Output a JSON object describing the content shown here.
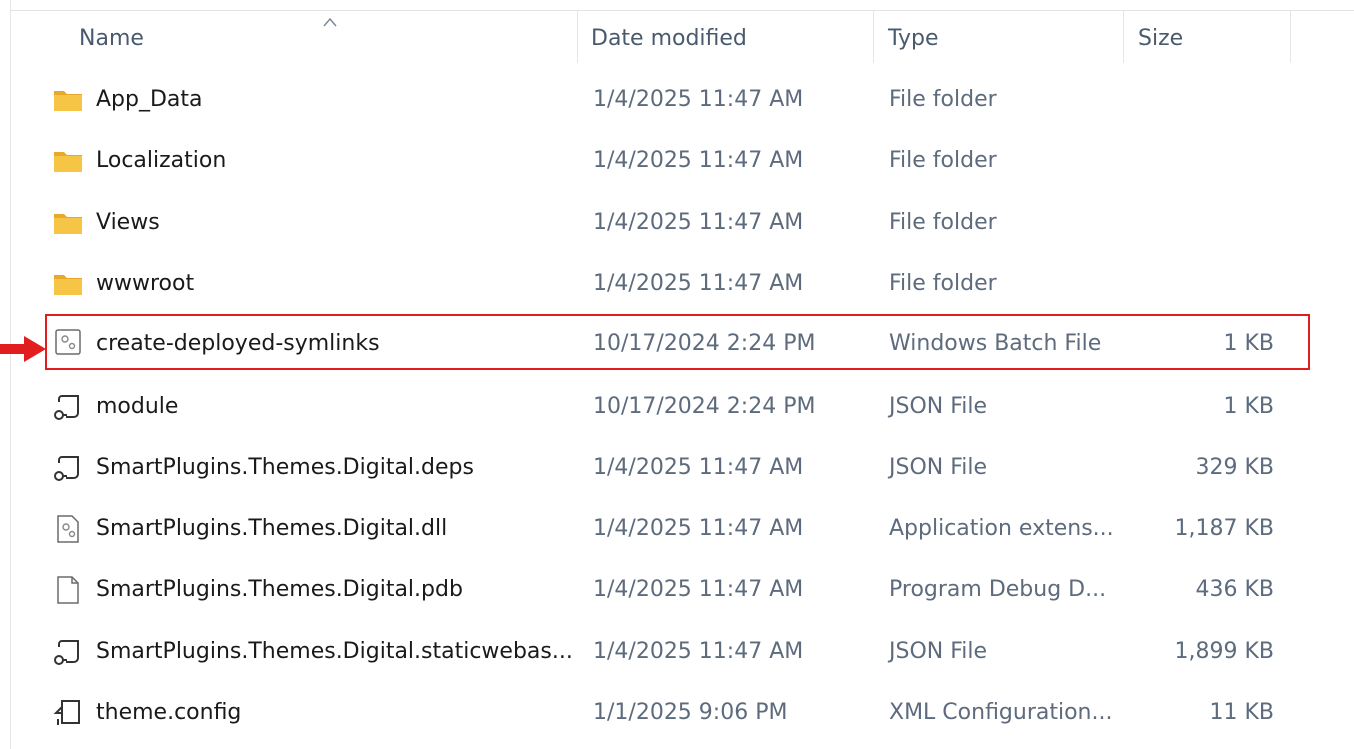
{
  "columns": {
    "name": "Name",
    "date": "Date modified",
    "type": "Type",
    "size": "Size"
  },
  "sort_icon": "chevron-up-icon",
  "files": [
    {
      "name": "App_Data",
      "date": "1/4/2025 11:47 AM",
      "type": "File folder",
      "size": "",
      "icon": "folder-icon"
    },
    {
      "name": "Localization",
      "date": "1/4/2025 11:47 AM",
      "type": "File folder",
      "size": "",
      "icon": "folder-icon"
    },
    {
      "name": "Views",
      "date": "1/4/2025 11:47 AM",
      "type": "File folder",
      "size": "",
      "icon": "folder-icon"
    },
    {
      "name": "wwwroot",
      "date": "1/4/2025 11:47 AM",
      "type": "File folder",
      "size": "",
      "icon": "folder-icon"
    },
    {
      "name": "create-deployed-symlinks",
      "date": "10/17/2024 2:24 PM",
      "type": "Windows Batch File",
      "size": "1 KB",
      "icon": "batch-file-icon",
      "highlighted": true
    },
    {
      "name": "module",
      "date": "10/17/2024 2:24 PM",
      "type": "JSON File",
      "size": "1 KB",
      "icon": "json-file-icon"
    },
    {
      "name": "SmartPlugins.Themes.Digital.deps",
      "date": "1/4/2025 11:47 AM",
      "type": "JSON File",
      "size": "329 KB",
      "icon": "json-file-icon"
    },
    {
      "name": "SmartPlugins.Themes.Digital.dll",
      "date": "1/4/2025 11:47 AM",
      "type": "Application extens...",
      "size": "1,187 KB",
      "icon": "dll-file-icon"
    },
    {
      "name": "SmartPlugins.Themes.Digital.pdb",
      "date": "1/4/2025 11:47 AM",
      "type": "Program Debug D...",
      "size": "436 KB",
      "icon": "blank-file-icon"
    },
    {
      "name": "SmartPlugins.Themes.Digital.staticwebas...",
      "date": "1/4/2025 11:47 AM",
      "type": "JSON File",
      "size": "1,899 KB",
      "icon": "json-file-icon"
    },
    {
      "name": "theme.config",
      "date": "1/1/2025 9:06 PM",
      "type": "XML Configuration...",
      "size": "11 KB",
      "icon": "config-file-icon"
    }
  ],
  "colors": {
    "highlight_border": "#e11d1d",
    "arrow": "#e11d1d",
    "folder": "#f5c13d",
    "muted_text": "#5d6b7d"
  }
}
